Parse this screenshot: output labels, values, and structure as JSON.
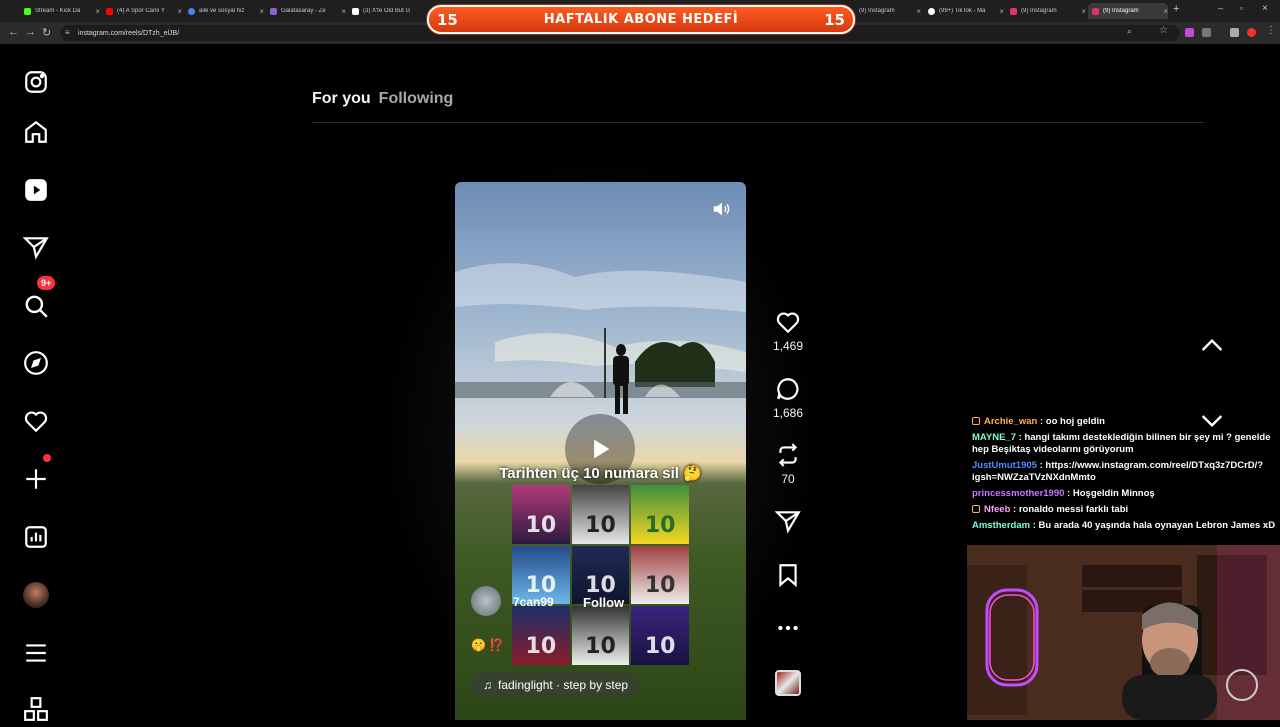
{
  "browser": {
    "tabs": [
      {
        "label": "Stream - Kick Da",
        "color": "#53fc18"
      },
      {
        "label": "(4) A Spor Canlı Y",
        "color": "#ff0000"
      },
      {
        "label": "aile ve sosyal hiz",
        "color": "#4285f4"
      },
      {
        "label": "Galatasaray - Ze",
        "color": "#8a63d2"
      },
      {
        "label": "(3) X'te Old But G",
        "color": "#ffffff"
      },
      {
        "label": "(9) Instagram",
        "color": "#e1306c"
      },
      {
        "label": "(99+) TikTok - Ma",
        "color": "#ffffff"
      },
      {
        "label": "(9) Instagram",
        "color": "#e1306c"
      },
      {
        "label": "(9) Instagram",
        "color": "#e1306c"
      }
    ],
    "url": "instagram.com/reels/DTzh_elJB/"
  },
  "banner": {
    "left_num": "15",
    "text": "HAFTALIK ABONE HEDEFİ",
    "right_num": "15"
  },
  "sidebar": {
    "notification_badge": "9+"
  },
  "feed_tabs": {
    "for_you": "For you",
    "following": "Following"
  },
  "reel": {
    "caption": "Tarihten üç 10 numara sil 🤔",
    "author": "7can99",
    "follow_label": "Follow",
    "emojis": "🤫 ⁉️",
    "music": "fadinglight · step by step",
    "grid_numbers": [
      "10",
      "10",
      "10",
      "10",
      "10",
      "10",
      "10",
      "10",
      "10"
    ]
  },
  "actions": {
    "likes": "1,469",
    "comments": "1,686",
    "reposts": "70"
  },
  "chat": [
    {
      "user": "Archie_wan",
      "text": "oo hoj geldin",
      "color": "#ffb347",
      "icon": true
    },
    {
      "user": "MAYNE_7",
      "text": "hangi takımı desteklediğin bilinen bir şey mi ? genelde hep Beşiktaş videolarını görüyorum",
      "color": "#7fffd4",
      "icon": false
    },
    {
      "user": "JustUmut1905",
      "text": "https://www.instagram.com/reel/DTxq3z7DCrD/?igsh=NWZzaTVzNXdnMmto",
      "color": "#4f8cff",
      "icon": false
    },
    {
      "user": "princessmother1990",
      "text": "Hoşgeldin Minnoş",
      "color": "#c678ff",
      "icon": false
    },
    {
      "user": "Nfeeb",
      "text": "ronaldo messi farklı tabi",
      "color": "#ff9dff",
      "icon": true
    },
    {
      "user": "Amstherdam",
      "text": "Bu arada 40 yaşında hala oynayan Lebron James xD",
      "color": "#7fffd4",
      "icon": false
    }
  ]
}
